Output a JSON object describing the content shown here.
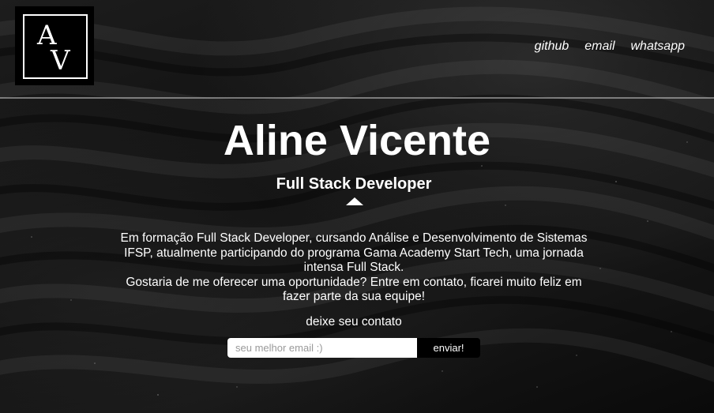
{
  "header": {
    "logo": {
      "letter_top": "A",
      "letter_bottom": "V"
    },
    "nav": [
      {
        "label": "github"
      },
      {
        "label": "email"
      },
      {
        "label": "whatsapp"
      }
    ]
  },
  "hero": {
    "name": "Aline Vicente",
    "role": "Full Stack Developer",
    "bio_lines": [
      "Em formação Full Stack Developer, cursando Análise e Desenvolvimento de Sistemas IFSP, atualmente participando do programa Gama Academy Start Tech, uma jornada intensa Full Stack.",
      "Gostaria de me oferecer uma oportunidade? Entre em contato, ficarei muito feliz em fazer parte da sua equipe!"
    ]
  },
  "contact": {
    "label": "deixe seu contato",
    "email_placeholder": "seu melhor email :)",
    "email_value": "",
    "submit_label": "enviar!"
  },
  "colors": {
    "background": "#0b0b0b",
    "text": "#ffffff",
    "button": "#000000"
  }
}
